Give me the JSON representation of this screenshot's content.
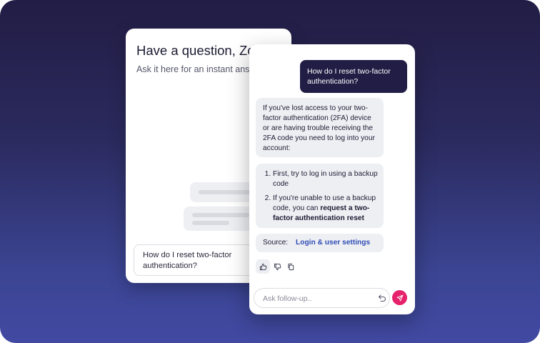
{
  "back_panel": {
    "title": "Have a question, Zoe",
    "subtitle": "Ask it here for an instant answ",
    "input_text": "How do I reset two-factor authentication?"
  },
  "chat": {
    "user_message": "How do I reset two-factor authentication?",
    "bot_intro": "If you've lost access to your two-factor authentication (2FA) device or are having trouble receiving the 2FA code you need to log into your account:",
    "steps": [
      {
        "text": "First, try to log in using a backup code"
      },
      {
        "text_before": "If you're unable to use a backup code, you can ",
        "bold": "request a two-factor authentication reset"
      }
    ],
    "source_label": "Source:",
    "source_link": "Login & user settings",
    "followup_placeholder": "Ask follow-up.."
  },
  "icons": [
    "thumbs-up-icon",
    "thumbs-down-icon",
    "copy-icon",
    "undo-icon",
    "send-icon"
  ],
  "colors": {
    "background_top": "#221d45",
    "background_bottom": "#4149a2",
    "user_bubble": "#221d45",
    "bot_bubble": "#eeeff3",
    "link": "#2f4fb5",
    "send_button": "#e5226b"
  }
}
